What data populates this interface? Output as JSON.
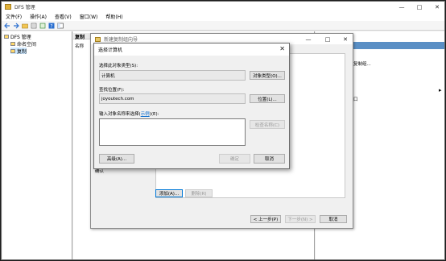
{
  "main_window": {
    "title": "DFS 管理",
    "controls": {
      "minimize": "—",
      "maximize": "□",
      "close": "✕"
    }
  },
  "menu": [
    "文件(F)",
    "操作(A)",
    "查看(V)",
    "窗口(W)",
    "帮助(H)"
  ],
  "toolbar": {
    "icons": [
      "back-icon",
      "forward-icon",
      "folder-icon",
      "properties-icon",
      "export-icon",
      "help-icon",
      "panel-icon"
    ]
  },
  "tree": {
    "root": "DFS 管理",
    "items": [
      "命名空间",
      "复制"
    ]
  },
  "center": {
    "header": "复制",
    "column": "名称"
  },
  "right_pane": {
    "items": [
      "复制组...",
      "口"
    ],
    "arrow": "▸"
  },
  "wizard": {
    "title": "新建复制组向导",
    "controls": {
      "minimize": "—",
      "maximize": "□",
      "close": "✕"
    },
    "left_label": "确认",
    "add_label": "添加(A)...",
    "delete_label": "删除(R)",
    "prev_label": "< 上一步(P)",
    "next_label": "下一步(N) >",
    "cancel_label": "取消"
  },
  "select_computer_dialog": {
    "title": "选择计算机",
    "close": "✕",
    "object_type_label": "选择此对象类型(S):",
    "object_type_value": "计算机",
    "object_type_button": "对象类型(O)...",
    "location_label": "查找位置(F):",
    "location_value": "joyoutech.com",
    "location_button": "位置(L)...",
    "names_label": "输入对象名称来选择(",
    "names_link": "示例",
    "names_label_end": ")(E):",
    "check_names_button": "检查名称(C)",
    "advanced_button": "高级(A)...",
    "ok_button": "确定",
    "cancel_button": "取消"
  }
}
